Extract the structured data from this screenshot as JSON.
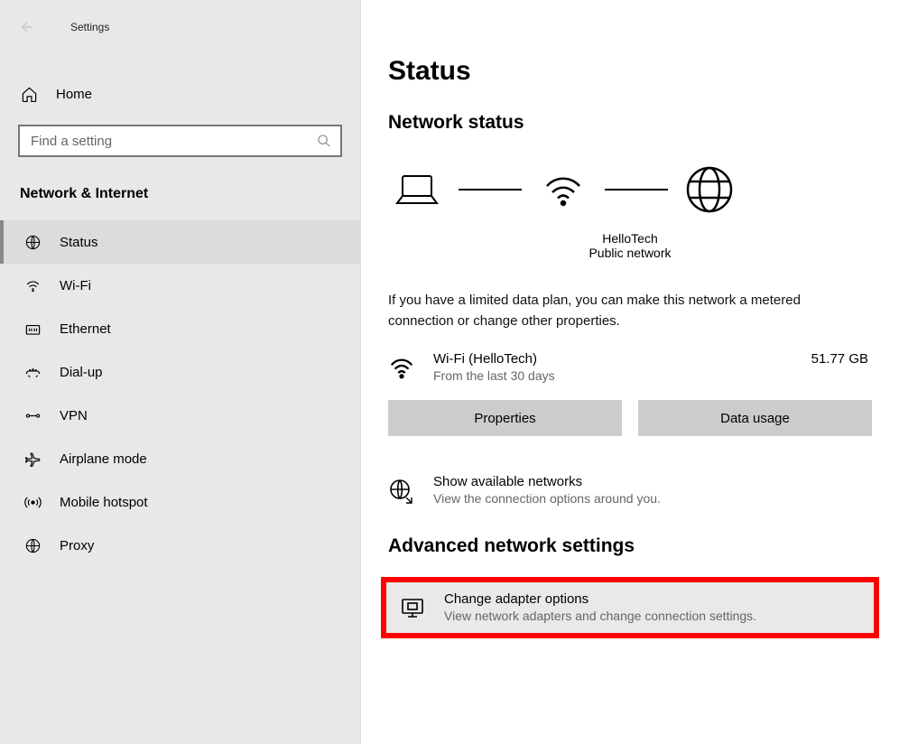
{
  "appTitle": "Settings",
  "home": {
    "label": "Home"
  },
  "search": {
    "placeholder": "Find a setting"
  },
  "sectionTitle": "Network & Internet",
  "nav": {
    "items": [
      {
        "label": "Status"
      },
      {
        "label": "Wi-Fi"
      },
      {
        "label": "Ethernet"
      },
      {
        "label": "Dial-up"
      },
      {
        "label": "VPN"
      },
      {
        "label": "Airplane mode"
      },
      {
        "label": "Mobile hotspot"
      },
      {
        "label": "Proxy"
      }
    ]
  },
  "main": {
    "pageTitle": "Status",
    "networkStatusTitle": "Network status",
    "networkName": "HelloTech",
    "networkType": "Public network",
    "metered": "If you have a limited data plan, you can make this network a metered connection or change other properties.",
    "wifi": {
      "name": "Wi-Fi (HelloTech)",
      "sub": "From the last 30 days",
      "size": "51.77 GB"
    },
    "propertiesBtn": "Properties",
    "dataUsageBtn": "Data usage",
    "showNetworks": {
      "title": "Show available networks",
      "sub": "View the connection options around you."
    },
    "advancedTitle": "Advanced network settings",
    "adapter": {
      "title": "Change adapter options",
      "sub": "View network adapters and change connection settings."
    }
  }
}
